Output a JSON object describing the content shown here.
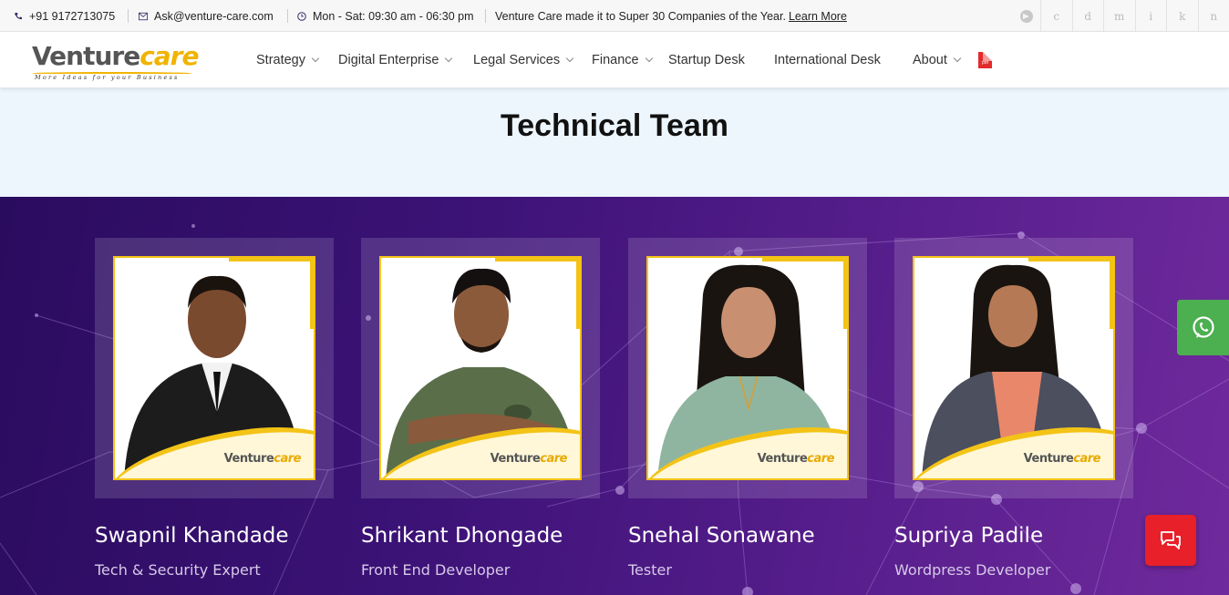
{
  "topbar": {
    "phone": "+91 9172713075",
    "email": "Ask@venture-care.com",
    "hours": "Mon - Sat: 09:30 am - 06:30 pm",
    "announcement": "Venture Care made it to Super 30 Companies of the Year.",
    "learn_more": "Learn More",
    "socials": [
      {
        "icon": "telegram-icon",
        "glyph": ""
      },
      {
        "icon": "social-c-icon",
        "glyph": "c"
      },
      {
        "icon": "social-d-icon",
        "glyph": "d"
      },
      {
        "icon": "social-m-icon",
        "glyph": "m"
      },
      {
        "icon": "social-i-icon",
        "glyph": "i"
      },
      {
        "icon": "social-k-icon",
        "glyph": "k"
      },
      {
        "icon": "social-n-icon",
        "glyph": "n"
      }
    ]
  },
  "header": {
    "logo": {
      "venture": "Venture",
      "care": "care",
      "tagline": "More Ideas for your Business"
    },
    "nav": [
      {
        "label": "Strategy",
        "dropdown": true
      },
      {
        "label": "Digital Enterprise",
        "dropdown": true
      },
      {
        "label": "Legal Services",
        "dropdown": true
      },
      {
        "label": "Finance",
        "dropdown": true
      },
      {
        "label": "Startup Desk",
        "dropdown": false
      },
      {
        "label": "International Desk",
        "dropdown": false
      },
      {
        "label": "About",
        "dropdown": true
      }
    ],
    "pdf_label": "pdf"
  },
  "page": {
    "title": "Technical Team"
  },
  "team": [
    {
      "name": "Swapnil Khandade",
      "role": "Tech & Security Expert"
    },
    {
      "name": "Shrikant Dhongade",
      "role": "Front End Developer"
    },
    {
      "name": "Snehal Sonawane",
      "role": "Tester"
    },
    {
      "name": "Supriya Padile",
      "role": "Wordpress Developer"
    }
  ],
  "photo_brand": {
    "venture": "Venture",
    "care": "care"
  },
  "colors": {
    "accent": "#f3c316",
    "section_bg": "#3b1276",
    "whatsapp": "#4caf50",
    "chat": "#e8202a"
  }
}
